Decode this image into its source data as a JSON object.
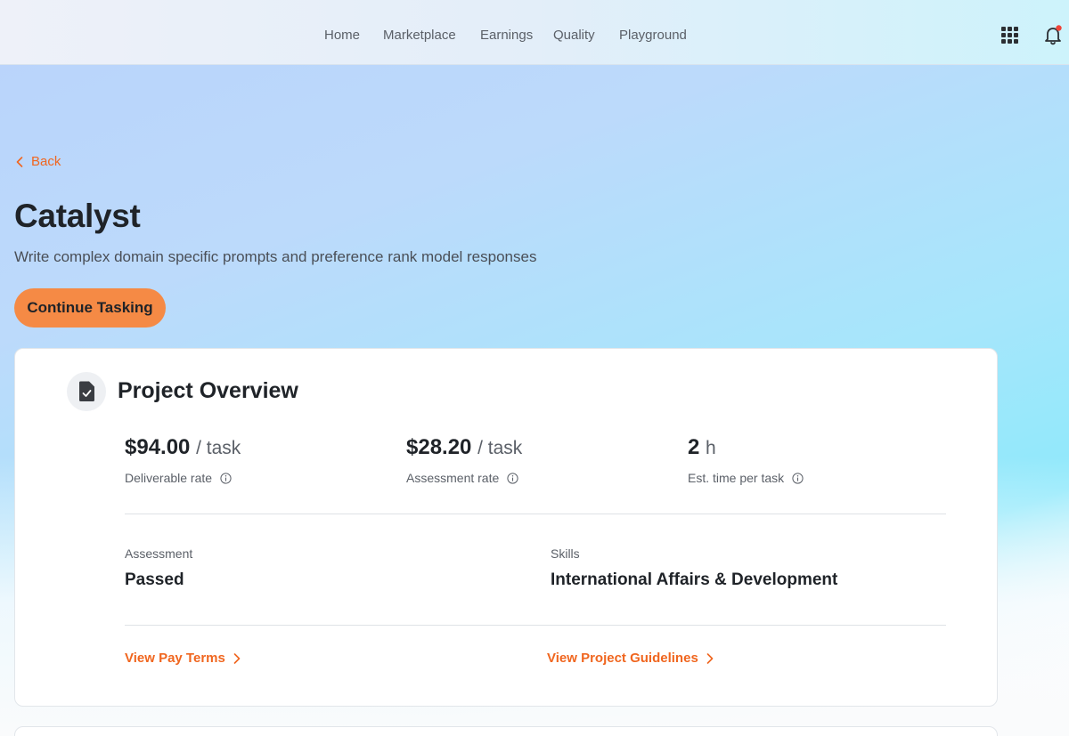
{
  "nav": {
    "items": [
      {
        "label": "Home"
      },
      {
        "label": "Marketplace"
      },
      {
        "label": "Earnings"
      },
      {
        "label": "Quality"
      },
      {
        "label": "Playground"
      }
    ],
    "icons": {
      "apps": "grid-icon",
      "notifications": "bell-icon"
    }
  },
  "back": {
    "label": "Back"
  },
  "project": {
    "title": "Catalyst",
    "subtitle": "Write complex domain specific prompts and preference rank model responses",
    "cta_label": "Continue Tasking"
  },
  "overview": {
    "title": "Project Overview",
    "metrics": [
      {
        "value": "$94.00",
        "unit": "/ task",
        "label": "Deliverable rate"
      },
      {
        "value": "$28.20",
        "unit": "/ task",
        "label": "Assessment rate"
      },
      {
        "value": "2",
        "unit": "h",
        "label": "Est. time per task"
      }
    ],
    "details": [
      {
        "label": "Assessment",
        "value": "Passed"
      },
      {
        "label": "Skills",
        "value": "International Affairs & Development"
      }
    ],
    "links": [
      {
        "label": "View Pay Terms"
      },
      {
        "label": "View Project Guidelines"
      }
    ]
  },
  "colors": {
    "accent": "#f0661f",
    "cta": "#f58a45",
    "notification_dot": "#f04438"
  }
}
